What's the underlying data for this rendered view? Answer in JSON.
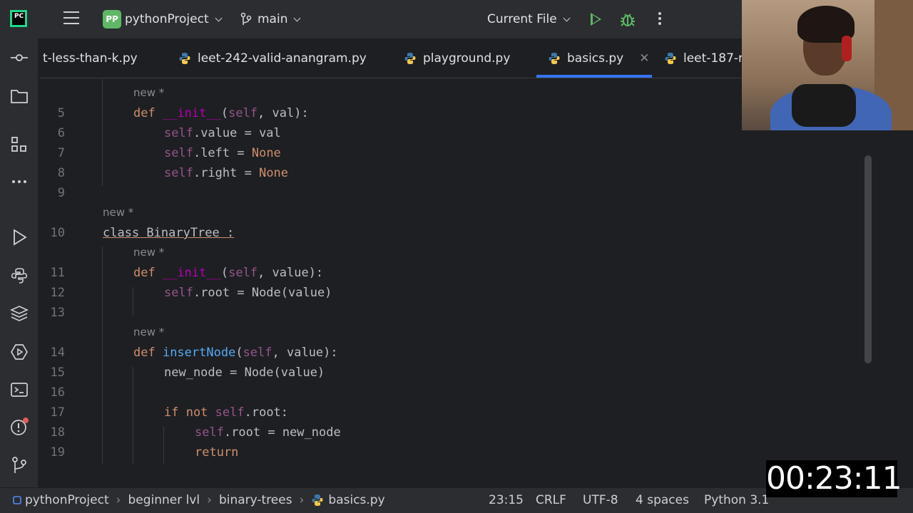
{
  "toolbar": {
    "project_badge": "PP",
    "project_name": "pythonProject",
    "branch": "main",
    "run_config": "Current File"
  },
  "tabs": [
    {
      "label": "t-less-than-k.py",
      "icon": "none"
    },
    {
      "label": "leet-242-valid-anangram.py",
      "icon": "python-file-icon"
    },
    {
      "label": "playground.py",
      "icon": "python-file-icon"
    },
    {
      "label": "basics.py",
      "icon": "python-file-icon",
      "active": true
    },
    {
      "label": "leet-187-r",
      "icon": "python-file-icon"
    }
  ],
  "editor": {
    "inlay_new": "new *",
    "lines": [
      {
        "n": "5",
        "tokens": [
          [
            "kw",
            "def "
          ],
          [
            "dunder",
            "__init__"
          ],
          [
            "pl",
            "("
          ],
          [
            "slf",
            "self"
          ],
          [
            "pl",
            ", val):"
          ]
        ]
      },
      {
        "n": "6",
        "tokens": [
          [
            "slf",
            "self"
          ],
          [
            "pl",
            ".value = val"
          ]
        ]
      },
      {
        "n": "7",
        "tokens": [
          [
            "slf",
            "self"
          ],
          [
            "pl",
            ".left = "
          ],
          [
            "kw",
            "None"
          ]
        ]
      },
      {
        "n": "8",
        "tokens": [
          [
            "slf",
            "self"
          ],
          [
            "pl",
            ".right = "
          ],
          [
            "kw",
            "None"
          ]
        ]
      },
      {
        "n": "9",
        "tokens": []
      },
      {
        "n": "10",
        "tokens": [
          [
            "cls",
            "class BinaryTree :"
          ]
        ]
      },
      {
        "n": "11",
        "tokens": [
          [
            "kw",
            "def "
          ],
          [
            "dunder",
            "__init__"
          ],
          [
            "pl",
            "("
          ],
          [
            "slf",
            "self"
          ],
          [
            "pl",
            ", value):"
          ]
        ]
      },
      {
        "n": "12",
        "tokens": [
          [
            "slf",
            "self"
          ],
          [
            "pl",
            ".root = Node(value)"
          ]
        ]
      },
      {
        "n": "13",
        "tokens": []
      },
      {
        "n": "14",
        "tokens": [
          [
            "kw",
            "def "
          ],
          [
            "fn",
            "insertNode"
          ],
          [
            "pl",
            "("
          ],
          [
            "slf",
            "self"
          ],
          [
            "pl",
            ", value):"
          ]
        ]
      },
      {
        "n": "15",
        "tokens": [
          [
            "pl",
            "new_node = Node(value)"
          ]
        ]
      },
      {
        "n": "16",
        "tokens": []
      },
      {
        "n": "17",
        "tokens": [
          [
            "kw",
            "if not "
          ],
          [
            "slf",
            "self"
          ],
          [
            "pl",
            ".root:"
          ]
        ]
      },
      {
        "n": "18",
        "tokens": [
          [
            "slf",
            "self"
          ],
          [
            "pl",
            ".root = new_node"
          ]
        ]
      },
      {
        "n": "19",
        "tokens": [
          [
            "kw",
            "return"
          ]
        ]
      }
    ]
  },
  "statusbar": {
    "breadcrumbs": [
      "pythonProject",
      "beginner lvl",
      "binary-trees",
      "basics.py"
    ],
    "position": "23:15",
    "line_ending": "CRLF",
    "encoding": "UTF-8",
    "indent": "4 spaces",
    "interpreter": "Python 3.1"
  },
  "overlay": {
    "timer": "00:23:11"
  }
}
